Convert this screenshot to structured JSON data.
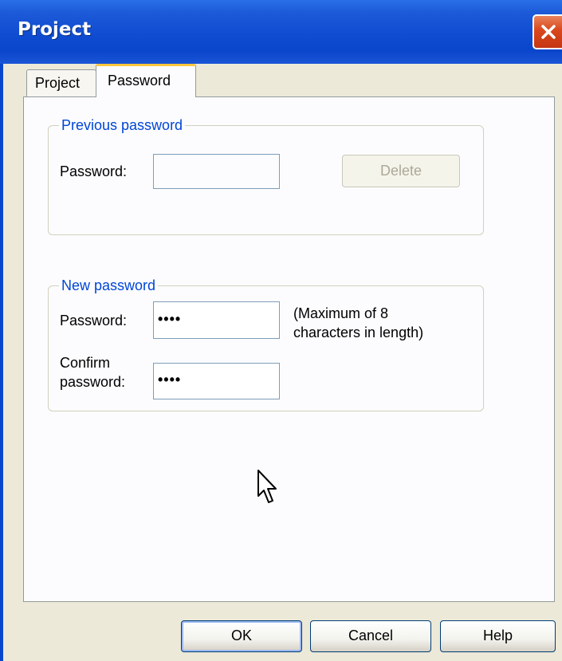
{
  "window": {
    "title": "Project"
  },
  "tabs": [
    {
      "label": "Project",
      "active": false
    },
    {
      "label": "Password",
      "active": true
    }
  ],
  "previous_password": {
    "group_title": "Previous password",
    "password_label": "Password:",
    "password_value": "",
    "delete_label": "Delete"
  },
  "new_password": {
    "group_title": "New password",
    "password_label": "Password:",
    "password_value": "••••",
    "hint_line1": "(Maximum of 8",
    "hint_line2": "characters in length)",
    "confirm_label_line1": "Confirm",
    "confirm_label_line2": "password:",
    "confirm_value": "••••"
  },
  "footer": {
    "ok_label": "OK",
    "cancel_label": "Cancel",
    "help_label": "Help"
  },
  "colors": {
    "titlebar": "#0a46cc",
    "close_button": "#d9471c",
    "dialog_background": "#ece9d8",
    "group_title": "#0046d5",
    "active_tab_accent": "#ffc73c"
  },
  "icons": {
    "close": "close-icon",
    "cursor": "mouse-pointer-icon"
  }
}
